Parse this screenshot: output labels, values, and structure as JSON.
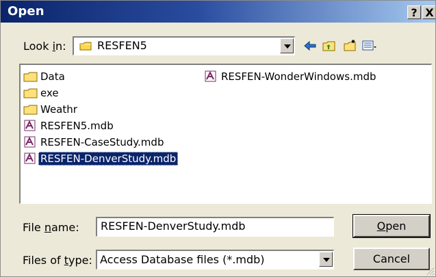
{
  "window": {
    "title": "Open",
    "help_label": "?",
    "close_label": "X"
  },
  "lookin": {
    "label_prefix": "Look ",
    "label_accel": "i",
    "label_suffix": "n:",
    "value": "RESFEN5"
  },
  "toolbar": {
    "icons": [
      "back-icon",
      "up-folder-icon",
      "new-folder-icon",
      "view-menu-icon"
    ]
  },
  "files": {
    "left_column": [
      {
        "name": "Data",
        "icon": "folder-icon",
        "selected": false
      },
      {
        "name": "exe",
        "icon": "folder-icon",
        "selected": false
      },
      {
        "name": "Weathr",
        "icon": "folder-icon",
        "selected": false
      },
      {
        "name": "RESFEN5.mdb",
        "icon": "access-db-icon",
        "selected": false
      },
      {
        "name": "RESFEN-CaseStudy.mdb",
        "icon": "access-db-icon",
        "selected": false
      },
      {
        "name": "RESFEN-DenverStudy.mdb",
        "icon": "access-db-icon",
        "selected": true
      }
    ],
    "right_column": [
      {
        "name": "RESFEN-WonderWindows.mdb",
        "icon": "access-db-icon",
        "selected": false
      }
    ]
  },
  "filename": {
    "label_prefix": "File ",
    "label_accel": "n",
    "label_suffix": "ame:",
    "value": "RESFEN-DenverStudy.mdb"
  },
  "filetype": {
    "label_prefix": "Files of ",
    "label_accel": "t",
    "label_suffix": "ype:",
    "value": "Access Database files (*.mdb)"
  },
  "buttons": {
    "open_accel": "O",
    "open_rest": "pen",
    "cancel": "Cancel"
  },
  "colors": {
    "titlebar_start": "#0a246a",
    "titlebar_end": "#a6caf0",
    "dialog_bg": "#ece9d8",
    "selection_bg": "#0a246a"
  }
}
